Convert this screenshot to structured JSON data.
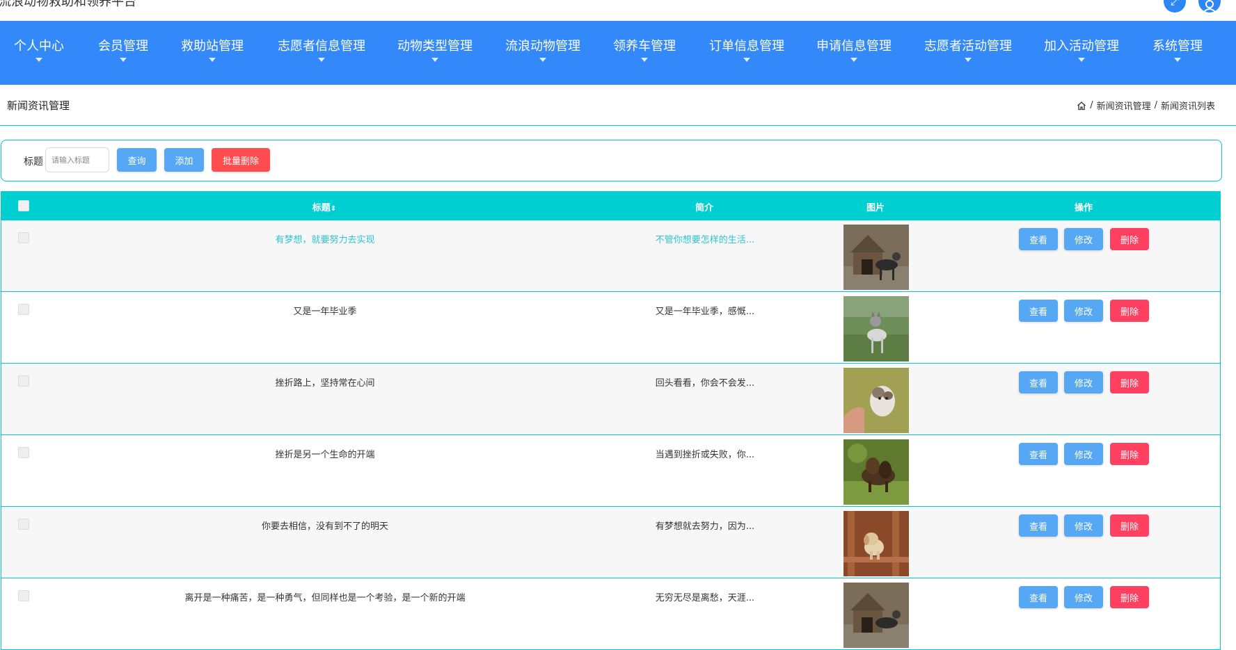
{
  "app": {
    "title": "流浪动物救助和领养平台",
    "icons": [
      "expand-icon",
      "user-icon"
    ]
  },
  "nav": {
    "items": [
      {
        "label": "个人中心",
        "name": "nav-personal-center"
      },
      {
        "label": "会员管理",
        "name": "nav-member-management"
      },
      {
        "label": "救助站管理",
        "name": "nav-rescue-station-management"
      },
      {
        "label": "志愿者信息管理",
        "name": "nav-volunteer-info-management"
      },
      {
        "label": "动物类型管理",
        "name": "nav-animal-type-management"
      },
      {
        "label": "流浪动物管理",
        "name": "nav-stray-animal-management"
      },
      {
        "label": "领养车管理",
        "name": "nav-adoption-cart-management"
      },
      {
        "label": "订单信息管理",
        "name": "nav-order-info-management"
      },
      {
        "label": "申请信息管理",
        "name": "nav-application-info-management"
      },
      {
        "label": "志愿者活动管理",
        "name": "nav-volunteer-activity-management"
      },
      {
        "label": "加入活动管理",
        "name": "nav-join-activity-management"
      },
      {
        "label": "系统管理",
        "name": "nav-system-management"
      }
    ],
    "color": "#3489fa"
  },
  "header": {
    "section_title": "新闻资讯管理",
    "breadcrumb": [
      "新闻资讯管理",
      "新闻资讯列表"
    ],
    "breadcrumb_sep": "/"
  },
  "search": {
    "label": "标题",
    "placeholder": "请输入标题",
    "value": "",
    "query_label": "查询",
    "add_label": "添加",
    "batch_delete_label": "批量删除"
  },
  "table": {
    "columns": [
      "标题",
      "简介",
      "图片",
      "操作"
    ],
    "sort_icon": "sort-icon",
    "header_color": "#00cfd2",
    "rows": [
      {
        "title": "有梦想，就要努力去实现",
        "intro": "不管你想要怎样的生活...",
        "image": "dog-kennel-photo",
        "active": true
      },
      {
        "title": "又是一年毕业季",
        "intro": "又是一年毕业季，感慨...",
        "image": "husky-grass-photo",
        "active": false
      },
      {
        "title": "挫折路上，坚持常在心间",
        "intro": "回头看看，你会不会发...",
        "image": "cat-hand-photo",
        "active": false
      },
      {
        "title": "挫折是另一个生命的开端",
        "intro": "当遇到挫折或失败，你...",
        "image": "dachshund-photo",
        "active": false
      },
      {
        "title": "你要去相信，没有到不了的明天",
        "intro": "有梦想就去努力，因为...",
        "image": "puppy-chair-photo",
        "active": false
      },
      {
        "title": "离开是一种痛苦，是一种勇气，但同样也是一个考验，是一个新的开端",
        "intro": "无穷无尽是离愁，天涯...",
        "image": "dog-kennel-photo",
        "active": false
      }
    ],
    "actions": {
      "view": "查看",
      "edit": "修改",
      "delete": "删除"
    }
  }
}
